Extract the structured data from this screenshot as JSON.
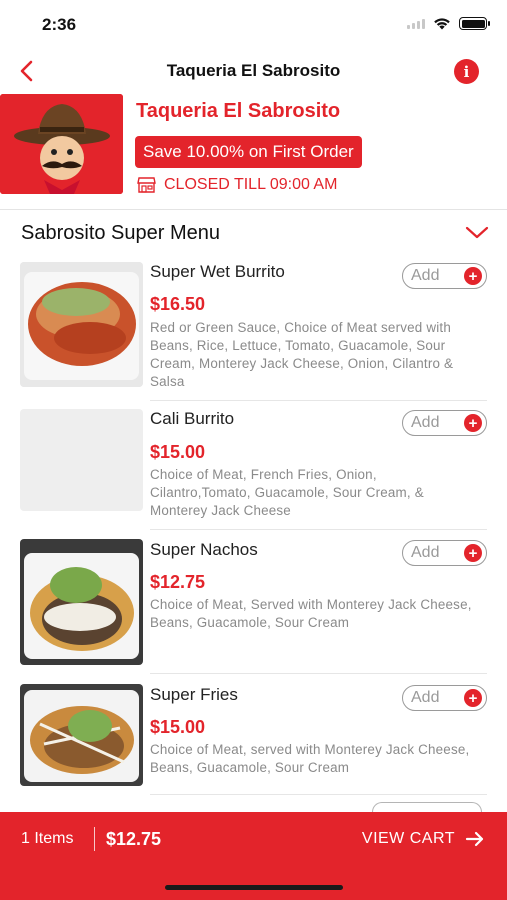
{
  "status_bar": {
    "time": "2:36"
  },
  "nav": {
    "title": "Taqueria El Sabrosito",
    "back_icon": "chevron-left-icon",
    "info_icon": "info-icon"
  },
  "restaurant": {
    "name": "Taqueria El Sabrosito",
    "promo": "Save 10.00% on First Order",
    "status": "CLOSED TILL 09:00 AM"
  },
  "menu": {
    "section_title": "Sabrosito Super Menu",
    "add_label": "Add",
    "items": [
      {
        "name": "Super Wet Burrito",
        "price": "$16.50",
        "description": "Red or Green Sauce, Choice of Meat served with Beans, Rice, Lettuce, Tomato, Guacamole, Sour Cream, Monterey Jack Cheese, Onion, Cilantro & Salsa"
      },
      {
        "name": "Cali Burrito",
        "price": "$15.00",
        "description": "Choice of Meat, French Fries, Onion, Cilantro,Tomato, Guacamole, Sour Cream, & Monterey Jack Cheese"
      },
      {
        "name": "Super Nachos",
        "price": "$12.75",
        "description": "Choice of Meat, Served with Monterey Jack Cheese, Beans, Guacamole, Sour Cream"
      },
      {
        "name": "Super Fries",
        "price": "$15.00",
        "description": "Choice of Meat, served with Monterey Jack Cheese, Beans, Guacamole, Sour Cream"
      }
    ]
  },
  "cart": {
    "count": "1 Items",
    "total": "$12.75",
    "view_label": "VIEW CART"
  },
  "colors": {
    "accent": "#e3242b",
    "muted_text": "#8a8a8a"
  }
}
